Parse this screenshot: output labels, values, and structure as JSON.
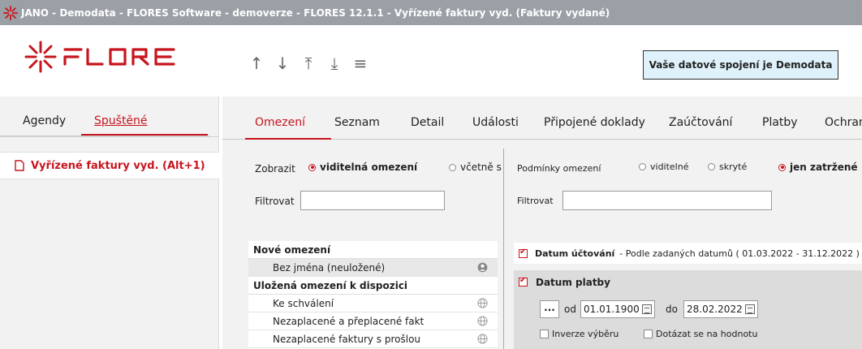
{
  "window": {
    "title": "JANO - Demodata - FLORES Software - demoverze - FLORES 12.1.1 - Vyřízené faktury vyd.  (Faktury vydané)"
  },
  "brand": {
    "accent": "#c7151e",
    "logo_text": "FLORES"
  },
  "header": {
    "nav_icons": [
      "arrow-up-icon",
      "arrow-down-icon",
      "arrow-to-top-icon",
      "arrow-to-bottom-icon",
      "menu-icon"
    ],
    "connection_label": "Vaše datové spojení je Demodata"
  },
  "left": {
    "tabs": [
      "Agendy",
      "Spuštěné"
    ],
    "active_tab": "Spuštěné",
    "item": "Vyřízené faktury vyd. (Alt+1)"
  },
  "main_tabs": [
    "Omezení",
    "Seznam",
    "Detail",
    "Události",
    "Připojené doklady",
    "Zaúčtování",
    "Platby",
    "Ochran"
  ],
  "omezeni": {
    "zobrazit_label": "Zobrazit",
    "radio_visible": "viditelná omezení",
    "radio_incl": "včetně s",
    "filter_label": "Filtrovat",
    "filter_value": "",
    "new_header": "Nové omezení",
    "unnamed": "Bez jména (neuložené)",
    "saved_header": "Uložená omezení k dispozici",
    "saved": [
      "Ke schválení",
      "Nezaplacené a přeplacené fakt",
      "Nezaplacené faktury s prošlou"
    ]
  },
  "podminky": {
    "label": "Podmínky omezení",
    "radio_visible": "viditelné",
    "radio_hidden": "skryté",
    "radio_checked": "jen zatržené",
    "filter_label": "Filtrovat",
    "filter_value": ""
  },
  "conditions": {
    "c1_name": "Datum účtování",
    "c1_desc": "- Podle zadaných datumů ( 01.03.2022 - 31.12.2022 )",
    "c2_name": "Datum platby",
    "c2_dots": "...",
    "c2_from_label": "od",
    "c2_from": "01.01.1900",
    "c2_to_label": "do",
    "c2_to": "28.02.2022",
    "c2_inverse": "Inverze výběru",
    "c2_ask": "Dotázat se na hodnotu"
  }
}
